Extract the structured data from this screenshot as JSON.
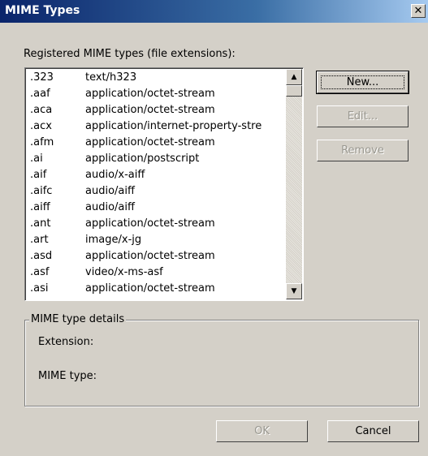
{
  "window": {
    "title": "MIME Types",
    "close_symbol": "✕"
  },
  "list": {
    "label": "Registered MIME types (file extensions):",
    "items": [
      {
        "ext": ".323",
        "type": "text/h323"
      },
      {
        "ext": ".aaf",
        "type": "application/octet-stream"
      },
      {
        "ext": ".aca",
        "type": "application/octet-stream"
      },
      {
        "ext": ".acx",
        "type": "application/internet-property-stre"
      },
      {
        "ext": ".afm",
        "type": "application/octet-stream"
      },
      {
        "ext": ".ai",
        "type": "application/postscript"
      },
      {
        "ext": ".aif",
        "type": "audio/x-aiff"
      },
      {
        "ext": ".aifc",
        "type": "audio/aiff"
      },
      {
        "ext": ".aiff",
        "type": "audio/aiff"
      },
      {
        "ext": ".ant",
        "type": "application/octet-stream"
      },
      {
        "ext": ".art",
        "type": "image/x-jg"
      },
      {
        "ext": ".asd",
        "type": "application/octet-stream"
      },
      {
        "ext": ".asf",
        "type": "video/x-ms-asf"
      },
      {
        "ext": ".asi",
        "type": "application/octet-stream"
      }
    ]
  },
  "buttons": {
    "new": "New...",
    "edit": "Edit...",
    "remove": "Remove",
    "ok": "OK",
    "cancel": "Cancel"
  },
  "details": {
    "title": "MIME type details",
    "extension_label": "Extension:",
    "mime_label": "MIME type:"
  },
  "scroll": {
    "up_arrow": "▲",
    "down_arrow": "▼"
  },
  "icons": {
    "close": "close-icon",
    "scroll_up": "arrow-up-icon",
    "scroll_down": "arrow-down-icon"
  }
}
